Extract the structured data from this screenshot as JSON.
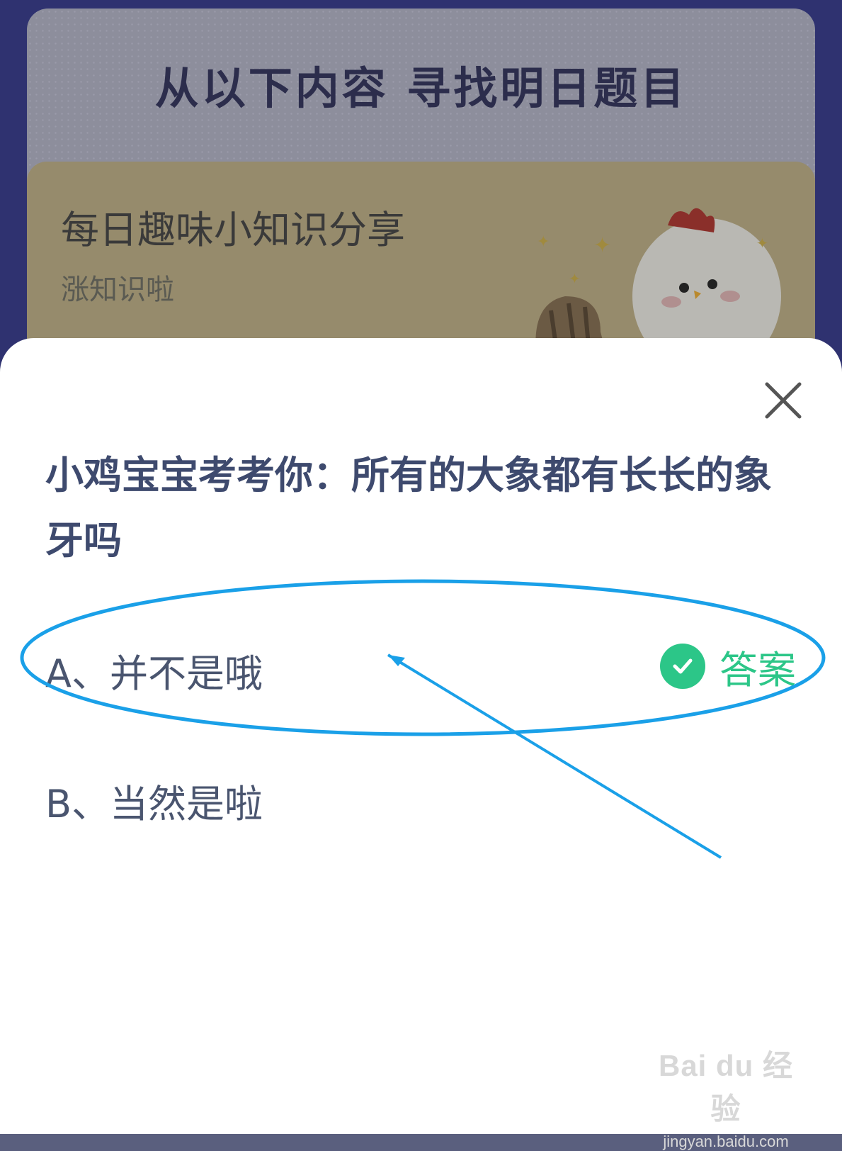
{
  "background": {
    "headline": "从以下内容 寻找明日题目",
    "banner_title": "每日趣味小知识分享",
    "banner_subtitle": "涨知识啦"
  },
  "quiz": {
    "question": "小鸡宝宝考考你：所有的大象都有长长的象牙吗",
    "options": [
      {
        "label": "A、并不是哦",
        "correct": true
      },
      {
        "label": "B、当然是啦",
        "correct": false
      }
    ],
    "answer_label": "答案",
    "close_icon": "close-icon",
    "correct_icon": "check-circle-icon"
  },
  "watermark": {
    "logo": "Bai du 经验",
    "url": "jingyan.baidu.com"
  },
  "colors": {
    "accent_green": "#2cc688",
    "annotation_blue": "#1aa0e8",
    "question_text": "#3e4a6e"
  }
}
